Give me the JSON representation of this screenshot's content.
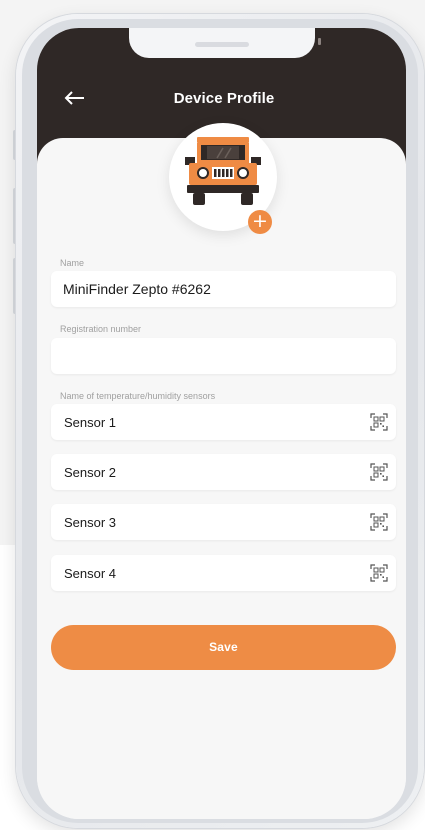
{
  "header": {
    "title": "Device Profile",
    "back_icon": "arrow-left-icon",
    "background_color": "#2f2826"
  },
  "avatar": {
    "icon": "car-icon",
    "add_icon": "plus-icon",
    "add_symbol": "+",
    "accent_color": "#ee8c45"
  },
  "form": {
    "name": {
      "label": "Name",
      "value": "MiniFinder Zepto #6262"
    },
    "registration": {
      "label": "Registration number",
      "value": ""
    },
    "sensors": {
      "label": "Name of temperature/humidity sensors",
      "items": [
        {
          "value": "Sensor 1",
          "icon": "qr-code-icon"
        },
        {
          "value": "Sensor 2",
          "icon": "qr-code-icon"
        },
        {
          "value": "Sensor 3",
          "icon": "qr-code-icon"
        },
        {
          "value": "Sensor 4",
          "icon": "qr-code-icon"
        }
      ]
    }
  },
  "actions": {
    "save_label": "Save"
  }
}
